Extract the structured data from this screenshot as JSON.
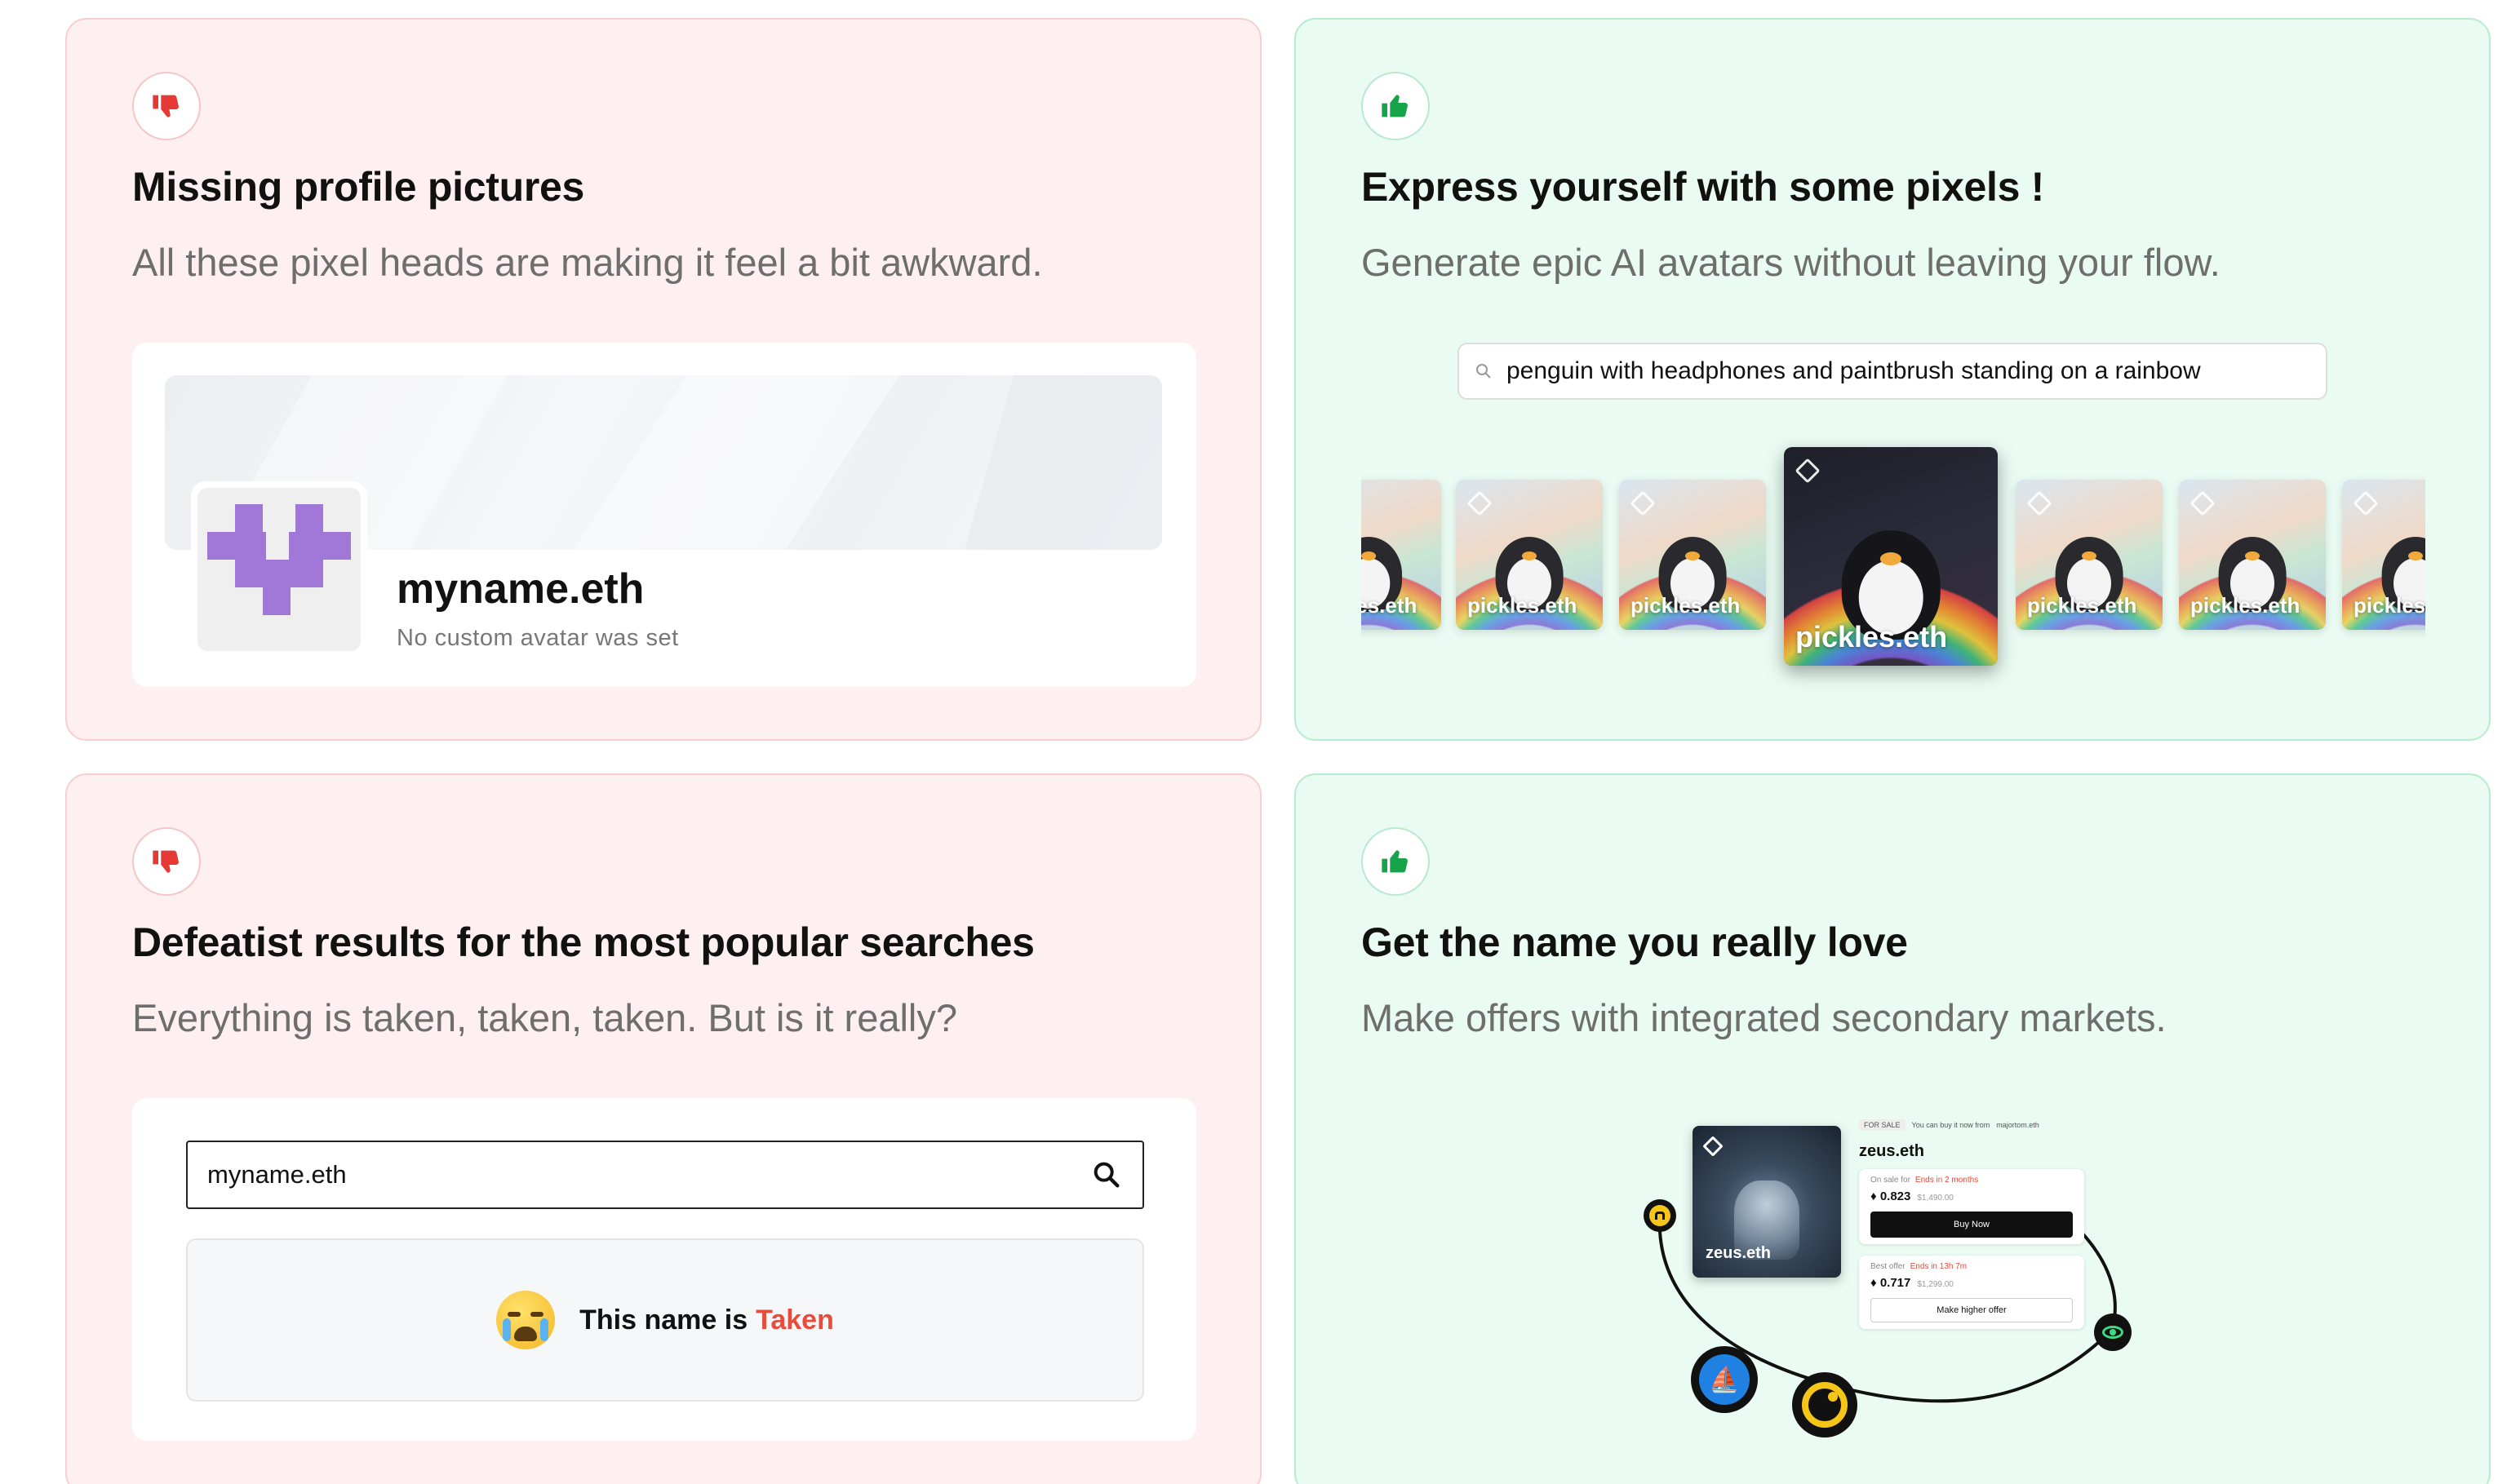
{
  "colors": {
    "bad_bg": "#fef0f0",
    "good_bg": "#e9fbf2",
    "thumb_down": "#e53935",
    "thumb_up": "#16a34a",
    "accent_red": "#e74c3c",
    "avatar_purple": "#a178d8"
  },
  "card_missing": {
    "icon": "thumbs-down-icon",
    "title": "Missing profile pictures",
    "subtitle": "All these pixel heads are making it feel a bit awkward.",
    "profile_name": "myname.eth",
    "profile_note": "No custom avatar was set"
  },
  "card_express": {
    "icon": "thumbs-up-icon",
    "title": "Express yourself with some pixels !",
    "subtitle": "Generate epic AI avatars without leaving your flow.",
    "prompt": "penguin with headphones and paintbrush standing on a rainbow",
    "avatar_label": "pickles.eth"
  },
  "card_defeatist": {
    "icon": "thumbs-down-icon",
    "title": "Defeatist results for the most popular searches",
    "subtitle": "Everything is taken, taken, taken. But is it really?",
    "search_value": "myname.eth",
    "result_prefix": "This name is",
    "result_status": "Taken"
  },
  "card_getname": {
    "icon": "thumbs-up-icon",
    "title": "Get the name you really love",
    "subtitle": "Make offers with integrated secondary markets.",
    "nft_label": "zeus.eth",
    "listing": {
      "tag": "FOR SALE",
      "buy_note": "You can buy it now from",
      "seller": "majortom.eth",
      "name": "zeus.eth",
      "sale_label": "On sale for",
      "sale_ends": "Ends in 2 months",
      "sale_price": "0.823",
      "sale_usd": "$1,490.00",
      "buy_button": "Buy Now",
      "offer_label": "Best offer",
      "offer_ends": "Ends in 13h 7m",
      "offer_price": "0.717",
      "offer_usd": "$1,299.00",
      "offer_button": "Make higher offer"
    }
  }
}
